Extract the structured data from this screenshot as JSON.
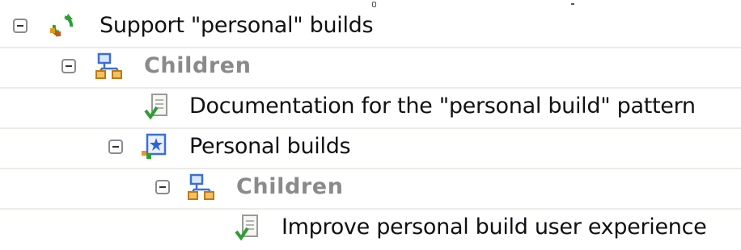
{
  "tree": {
    "items": [
      {
        "label": "Support \"personal\" builds",
        "icon": "cycle-plan-icon",
        "expanded": true,
        "kind": "work-item"
      },
      {
        "label": "Children",
        "icon": "hierarchy-icon",
        "expanded": true,
        "kind": "group"
      },
      {
        "label": "Documentation for the \"personal build\" pattern",
        "icon": "task-check-icon",
        "expanded": null,
        "kind": "work-item"
      },
      {
        "label": "Personal builds",
        "icon": "story-star-icon",
        "expanded": true,
        "kind": "work-item"
      },
      {
        "label": "Children",
        "icon": "hierarchy-icon",
        "expanded": true,
        "kind": "group"
      },
      {
        "label": "Improve personal build user experience",
        "icon": "task-check-icon",
        "expanded": null,
        "kind": "work-item"
      }
    ]
  },
  "colors": {
    "group_label": "#8a8a8a",
    "text": "#111111",
    "icon_blue": "#3a6fd8",
    "icon_green": "#2e9e33",
    "icon_orange": "#e59a1c"
  }
}
